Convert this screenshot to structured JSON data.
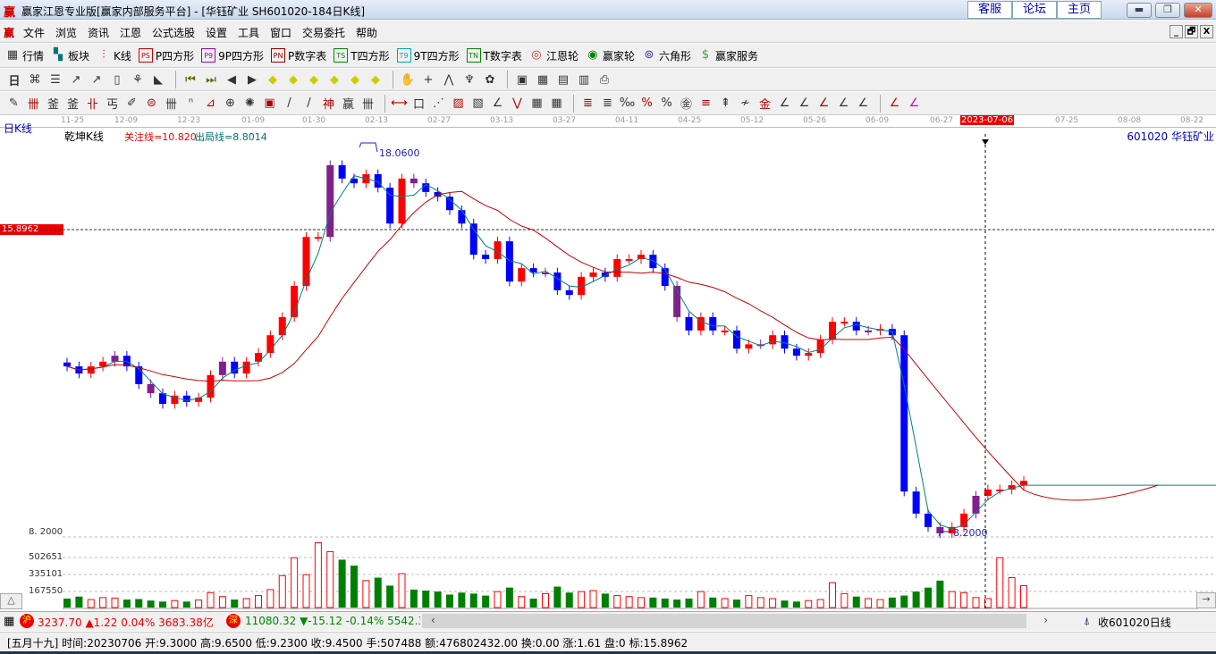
{
  "window": {
    "logo": "赢",
    "title": "赢家江恩专业版[赢家内部服务平台] - [华钰矿业  SH601020-184日K线]",
    "links": [
      "客服",
      "论坛",
      "主页"
    ],
    "controls": [
      "minimize",
      "restore",
      "close"
    ]
  },
  "menu": {
    "logo": "赢",
    "items": [
      "文件",
      "浏览",
      "资讯",
      "江恩",
      "公式选股",
      "设置",
      "工具",
      "窗口",
      "交易委托",
      "帮助"
    ],
    "mdi": [
      "_",
      "🗗",
      "X"
    ]
  },
  "toolbar1": [
    {
      "icon": "grid-icon",
      "glyph": "▦",
      "label": "行情"
    },
    {
      "icon": "blocks-icon",
      "glyph": "▚",
      "label": "板块"
    },
    {
      "icon": "kline-icon",
      "glyph": "⫶",
      "label": "K线"
    },
    {
      "icon": "ps-icon",
      "glyph": "PS",
      "label": "P四方形"
    },
    {
      "icon": "p9-icon",
      "glyph": "P9",
      "label": "9P四方形"
    },
    {
      "icon": "pn-icon",
      "glyph": "PN",
      "label": "P数字表"
    },
    {
      "icon": "ts-icon",
      "glyph": "TS",
      "label": "T四方形"
    },
    {
      "icon": "t9-icon",
      "glyph": "T9",
      "label": "9T四方形"
    },
    {
      "icon": "tn-icon",
      "glyph": "TN",
      "label": "T数字表"
    },
    {
      "icon": "gann-wheel-icon",
      "glyph": "◎",
      "label": "江恩轮"
    },
    {
      "icon": "winner-wheel-icon",
      "glyph": "◉",
      "label": "赢家轮"
    },
    {
      "icon": "hexagon-icon",
      "glyph": "⊚",
      "label": "六角形"
    },
    {
      "icon": "dollar-icon",
      "glyph": "$",
      "label": "赢家服务"
    }
  ],
  "toolbar2": {
    "period": "日",
    "icons": [
      "kline-mode-icon",
      "notes-icon",
      "chart3-icon",
      "chart9-icon",
      "candle-icon",
      "special-icon",
      "flag-icon",
      "first-icon",
      "last-icon",
      "left-icon",
      "right-icon",
      "left-diamond-icon",
      "right-diamond-icon",
      "expand-icon",
      "shrink-icon",
      "zoom-in-icon",
      "zoom-all-icon",
      "hand-icon",
      "crosshair-icon",
      "pen-icon",
      "tool-icon",
      "pattern-icon",
      "calendar-icon",
      "calculator-icon",
      "report-icon",
      "save-icon",
      "print-icon"
    ]
  },
  "toolbar3": {
    "icons": [
      "pencil-icon",
      "lines-icon",
      "gold1-icon",
      "gold2-icon",
      "fib-icon",
      "spiral-icon",
      "marker-icon",
      "circle-icon",
      "parallel-icon",
      "n2-icon",
      "angle-icon",
      "target-icon",
      "web-icon",
      "square-icon",
      "vlines-icon",
      "shen-icon",
      "ying-icon",
      "cycle-icon",
      "range-icon",
      "box-icon",
      "fan-icon",
      "arc-icon",
      "square-fan-icon",
      "angle2-icon",
      "zigzag-icon",
      "grid2-icon",
      "grid3-icon",
      "speed-icon",
      "table-icon",
      "percent1-icon",
      "percent-icon",
      "percent2-icon",
      "gold-coin-icon",
      "gold-lines-icon",
      "pen2-icon",
      "wave-icon",
      "gold3-icon",
      "l-angle-icon",
      "f-angle-icon",
      "gold-angle-icon",
      "shen-angle-icon",
      "ying-angle-icon",
      "four-angle-icon",
      "yinyang-icon",
      "infinity-icon"
    ]
  },
  "chart": {
    "period_label": "日K线",
    "indicator_name": "乾坤K线",
    "focus_line": "关注线=10.820",
    "exit_line": "出局线=8.8014",
    "stock": "601020 华钰矿业",
    "dates": [
      "11-25",
      "12-09",
      "12-23",
      "01-09",
      "01-30",
      "02-13",
      "02-27",
      "03-13",
      "03-27",
      "04-11",
      "04-25",
      "05-12",
      "05-26",
      "06-09",
      "06-27",
      "2023-07-06",
      "07-25",
      "08-08",
      "08-22"
    ],
    "cursor_price": "15.8962",
    "high_label": "18.0600",
    "low_label": "8.2000",
    "low_axis": "8. 2000",
    "vol_ticks": [
      "502651",
      "335101",
      "167550"
    ]
  },
  "chart_data": {
    "type": "candlestick",
    "closes": [
      12.43,
      12.25,
      12.43,
      12.55,
      12.7,
      12.43,
      11.98,
      11.75,
      11.48,
      11.69,
      11.53,
      11.64,
      12.21,
      12.55,
      12.25,
      12.55,
      12.77,
      13.22,
      13.68,
      14.47,
      15.71,
      15.71,
      17.53,
      17.19,
      17.07,
      17.3,
      16.96,
      16.05,
      17.19,
      17.07,
      16.85,
      16.73,
      16.39,
      16.05,
      15.26,
      15.15,
      15.6,
      14.58,
      14.92,
      14.81,
      14.81,
      14.36,
      14.24,
      14.7,
      14.81,
      14.7,
      15.15,
      15.15,
      15.26,
      14.92,
      14.47,
      13.68,
      13.34,
      13.68,
      13.34,
      13.34,
      12.88,
      12.99,
      12.99,
      13.22,
      12.88,
      12.7,
      12.77,
      13.11,
      13.56,
      13.56,
      13.34,
      13.34,
      13.38,
      13.22,
      9.26,
      8.7,
      8.36,
      8.2,
      8.36,
      8.7,
      9.15,
      9.31,
      9.31,
      9.42,
      9.53
    ],
    "volumes": [
      90000,
      110000,
      80000,
      100000,
      95000,
      80000,
      85000,
      70000,
      60000,
      70000,
      60000,
      75000,
      150000,
      110000,
      80000,
      90000,
      120000,
      180000,
      320000,
      500000,
      330000,
      650000,
      560000,
      480000,
      420000,
      270000,
      300000,
      220000,
      340000,
      180000,
      170000,
      160000,
      130000,
      150000,
      140000,
      120000,
      160000,
      200000,
      110000,
      90000,
      140000,
      210000,
      150000,
      160000,
      170000,
      140000,
      120000,
      110000,
      100000,
      100000,
      90000,
      80000,
      90000,
      160000,
      100000,
      90000,
      80000,
      120000,
      100000,
      90000,
      70000,
      60000,
      70000,
      80000,
      250000,
      140000,
      110000,
      90000,
      80000,
      100000,
      120000,
      160000,
      200000,
      270000,
      160000,
      150000,
      100000,
      90000,
      500000,
      300000,
      220000
    ],
    "ylim": [
      8.2,
      18.06
    ],
    "ma_short": 3,
    "ma_long": 12
  },
  "index_bar": {
    "sh": "沪",
    "sh_value": "3237.70 ▲1.22 0.04% 3683.38亿",
    "sz": "深",
    "sz_value": "11080.32 ▼-15.12 -0.14% 5542.38",
    "right": "收601020日线"
  },
  "status": {
    "text": "[五月十九] 时间:20230706 开:9.3000 高:9.6500 低:9.2300 收:9.4500 手:507488 额:476802432.00 换:0.00 涨:1.61 盘:0 标:15.8962"
  },
  "colors": {
    "up": "#ff0000",
    "down": "#0000ff",
    "vol_down": "#008000",
    "ma_short": "#008080",
    "ma_long": "#cc0000"
  }
}
